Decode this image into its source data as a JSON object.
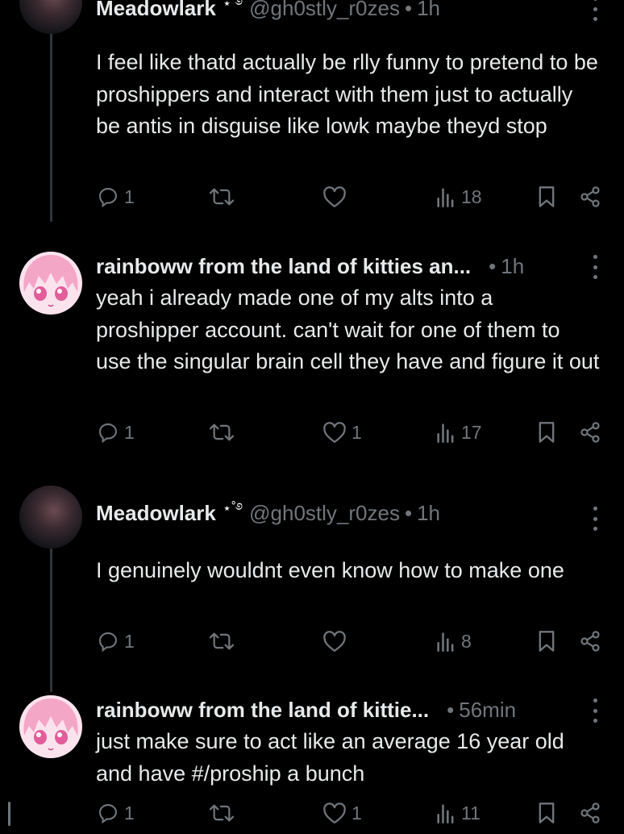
{
  "posts": [
    {
      "author": "Meadowlark",
      "badge": "⋆˚࿔",
      "handle": "@gh0stly_r0zes",
      "time": "1h",
      "text": "I feel like thatd actually be rlly funny to pretend to be proshippers and interact with them just to actually be antis in disguise like lowk maybe theyd stop",
      "replies": "1",
      "reposts": "",
      "likes": "",
      "views": "18"
    },
    {
      "author": "rainboww from the land of kitties an...",
      "badge": "",
      "handle": "",
      "time": "1h",
      "text": "yeah i already made one of my alts into a proshipper account. can't wait for one of them to use the singular brain cell they have and figure it out",
      "replies": "1",
      "reposts": "",
      "likes": "1",
      "views": "17"
    },
    {
      "author": "Meadowlark",
      "badge": "⋆˚࿔",
      "handle": "@gh0stly_r0zes",
      "time": "1h",
      "text": "I genuinely wouldnt even know how to make one",
      "replies": "1",
      "reposts": "",
      "likes": "",
      "views": "8"
    },
    {
      "author": "rainboww from the land of kittie...",
      "badge": "",
      "handle": "",
      "time": "56min",
      "text": "just make sure to act like an average 16 year old and have #/proship a bunch",
      "replies": "1",
      "reposts": "",
      "likes": "1",
      "views": "11"
    }
  ],
  "separator": "•",
  "icons": {
    "reply": "reply-icon",
    "repost": "repost-icon",
    "like": "heart-icon",
    "views": "views-icon",
    "bookmark": "bookmark-icon",
    "share": "share-icon",
    "more": "more-icon"
  },
  "colors": {
    "background": "#000000",
    "text": "#e7e9ea",
    "muted": "#71767b",
    "thread_line": "#333639"
  }
}
